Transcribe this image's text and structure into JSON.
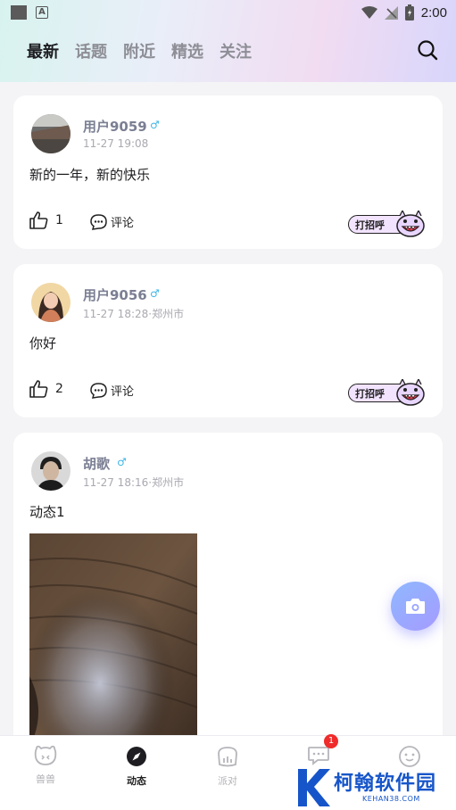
{
  "status_bar": {
    "time": "2:00"
  },
  "tabs": [
    {
      "label": "最新",
      "active": true
    },
    {
      "label": "话题",
      "active": false
    },
    {
      "label": "附近",
      "active": false
    },
    {
      "label": "精选",
      "active": false
    },
    {
      "label": "关注",
      "active": false
    }
  ],
  "posts": [
    {
      "username": "用户9059",
      "gender": "♂",
      "meta": "11-27 19:08",
      "content": "新的一年，新的快乐",
      "likes": "1",
      "comment_label": "评论",
      "greet_label": "打招呼"
    },
    {
      "username": "用户9056",
      "gender": "♂",
      "meta": "11-27 18:28·郑州市",
      "content": "你好",
      "likes": "2",
      "comment_label": "评论",
      "greet_label": "打招呼"
    },
    {
      "username": "胡歌",
      "gender": "♂",
      "meta": "11-27 18:16·郑州市",
      "content": "动态1"
    }
  ],
  "bottom_nav": [
    {
      "label": "兽兽",
      "icon": "bear-icon",
      "active": false
    },
    {
      "label": "动态",
      "icon": "compass-icon",
      "active": true
    },
    {
      "label": "派对",
      "icon": "party-icon",
      "active": false
    },
    {
      "label": "",
      "icon": "message-icon",
      "active": false,
      "badge": "1"
    },
    {
      "label": "",
      "icon": "face-icon",
      "active": false
    }
  ],
  "watermark": {
    "text": "柯翰软件园",
    "sub": "KEHAN38.COM"
  },
  "colors": {
    "accent": "#a59bff",
    "gender": "#3fb6e6",
    "badge": "#f02b2b",
    "watermark": "#1655c9"
  }
}
